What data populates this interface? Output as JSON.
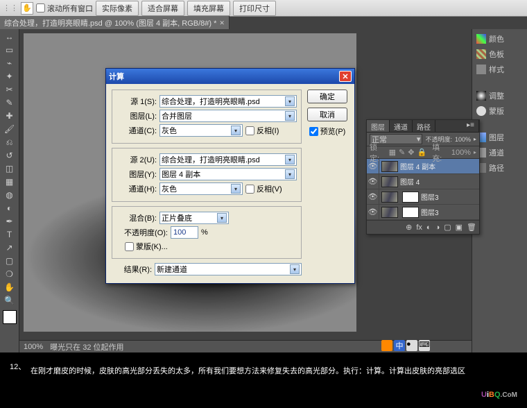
{
  "topbar": {
    "scroll_all": "滚动所有窗口",
    "b1": "实际像素",
    "b2": "适合屏幕",
    "b3": "填充屏幕",
    "b4": "打印尺寸"
  },
  "doctab": {
    "title": "综合处理，打造明亮眼睛.psd @ 100% (图层 4 副本, RGB/8#) *"
  },
  "status": {
    "zoom": "100%",
    "msg": "曝光只在 32 位起作用"
  },
  "rpanel": {
    "color": "颜色",
    "swatch": "色板",
    "style": "样式",
    "adjust": "调整",
    "mask": "蒙版",
    "layers": "图层",
    "channels": "通道",
    "paths": "路径"
  },
  "dlg": {
    "title": "计算",
    "src1": "源 1(S):",
    "src1_val": "综合处理，打造明亮眼睛.psd",
    "layer_l": "图层(L):",
    "layer_l_val": "合并图层",
    "chan_c": "通道(C):",
    "chan_c_val": "灰色",
    "invert_i": "反相(I)",
    "src2": "源 2(U):",
    "src2_val": "综合处理，打造明亮眼睛.psd",
    "layer_y": "图层(Y):",
    "layer_y_val": "图层 4 副本",
    "chan_h": "通道(H):",
    "chan_h_val": "灰色",
    "invert_v": "反相(V)",
    "blend": "混合(B):",
    "blend_val": "正片叠底",
    "opacity": "不透明度(O):",
    "opacity_val": "100",
    "pct": "%",
    "mask": "蒙版(K)...",
    "result": "结果(R):",
    "result_val": "新建通道",
    "ok": "确定",
    "cancel": "取消",
    "preview": "预览(P)"
  },
  "layers": {
    "tab_layer": "图层",
    "tab_channel": "通道",
    "tab_path": "路径",
    "mode": "正常",
    "opac_lbl": "不透明度:",
    "opac": "100%",
    "lock": "锁定:",
    "fill_lbl": "填充:",
    "fill": "100%",
    "l1": "图层 4 副本",
    "l2": "图层 4",
    "l3": "图层3",
    "l4": "图层3"
  },
  "caption": {
    "num": "12、",
    "text": "在刚才磨皮的时候，皮肤的高光部分丢失的太多，所有我们要想方法来修复失去的高光部分。执行：计算。计算出皮肤的亮部选区"
  },
  "logo": {
    "u": "U",
    "i": "i",
    "b": "B",
    "q": "Q",
    "dot": ".CoM"
  }
}
